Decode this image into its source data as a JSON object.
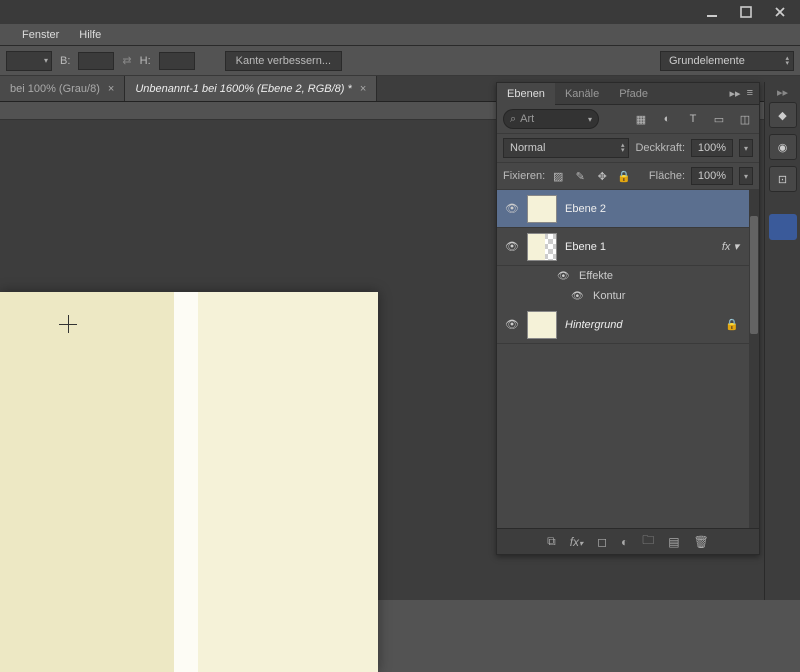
{
  "menu": {
    "fenster": "Fenster",
    "hilfe": "Hilfe"
  },
  "optbar": {
    "b": "B:",
    "h": "H:",
    "kante": "Kante verbessern...",
    "preset": "Grundelemente"
  },
  "tabs": [
    {
      "label": "bei 100% (Grau/8)",
      "active": false
    },
    {
      "label": "Unbenannt-1 bei 1600% (Ebene 2, RGB/8) *",
      "active": true
    }
  ],
  "panel": {
    "tabs": {
      "ebenen": "Ebenen",
      "kanale": "Kanäle",
      "pfade": "Pfade"
    },
    "search": {
      "placeholder": "Art",
      "icon": "⌕"
    },
    "blend": "Normal",
    "opacity": {
      "label": "Deckkraft:",
      "value": "100%"
    },
    "fill": {
      "label": "Fläche:",
      "value": "100%"
    },
    "fix": "Fixieren:"
  },
  "layers": [
    {
      "name": "Ebene 2",
      "selected": true,
      "kind": "plain"
    },
    {
      "name": "Ebene 1",
      "kind": "checker",
      "fx": true
    },
    {
      "name": "Hintergrund",
      "kind": "plain",
      "italic": true,
      "locked": true
    }
  ],
  "effects": {
    "effekte": "Effekte",
    "kontur": "Kontur"
  }
}
